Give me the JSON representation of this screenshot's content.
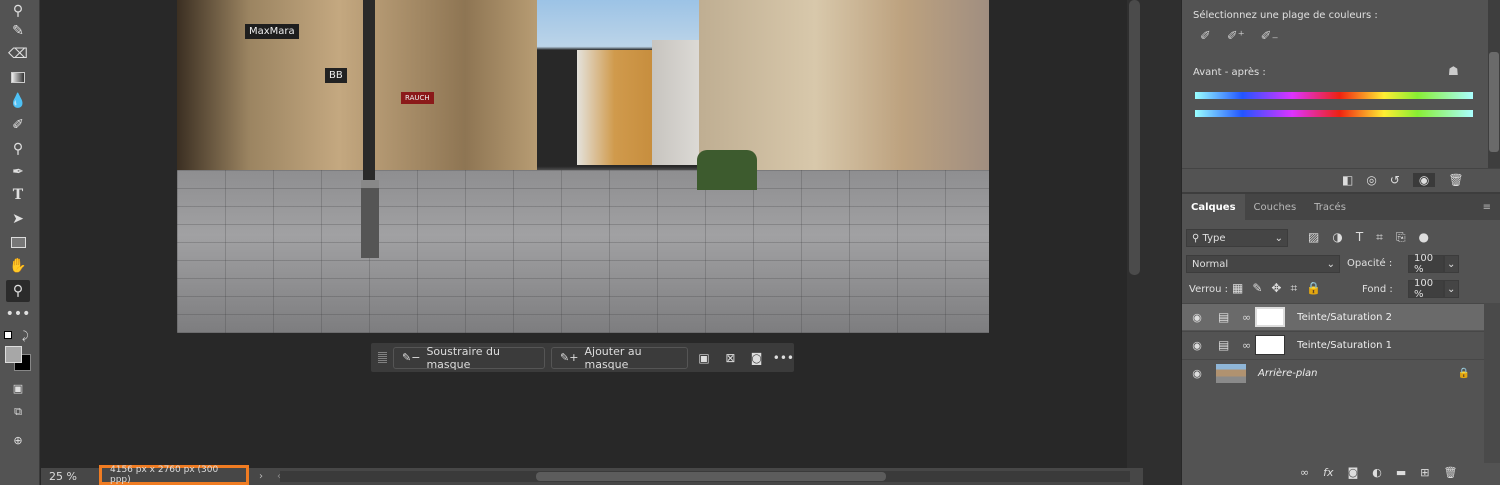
{
  "toolbar": {
    "tools": [
      "stamp-icon",
      "history-brush-icon",
      "eraser-icon",
      "gradient-icon",
      "blur-icon",
      "dodge-icon",
      "sponge-icon",
      "pen-icon",
      "type-icon",
      "path-selection-icon",
      "rectangle-icon",
      "hand-icon",
      "zoom-icon",
      "more-icon"
    ],
    "type_glyph": "T"
  },
  "context_bar": {
    "subtract_label": "Soustraire du masque",
    "add_label": "Ajouter au masque",
    "more": "•••"
  },
  "status": {
    "zoom": "25 %",
    "doc_info": "4156 px x 2760 px (300 ppp)",
    "arrow": "›",
    "left_arrow": "‹"
  },
  "photo": {
    "signs": [
      "MaxMara",
      "BB",
      "RAUCH"
    ]
  },
  "properties": {
    "select_range_label": "Sélectionnez une plage de couleurs :",
    "before_after_label": "Avant - après :"
  },
  "layers_panel": {
    "tabs": [
      "Calques",
      "Couches",
      "Tracés"
    ],
    "filter": "Type",
    "blend_mode": "Normal",
    "opacity_label": "Opacité :",
    "opacity": "100 %",
    "lock_label": "Verrou :",
    "fill_label": "Fond :",
    "fill": "100 %",
    "layers": [
      {
        "name": "Teinte/Saturation 2",
        "selected": true
      },
      {
        "name": "Teinte/Saturation 1",
        "selected": false
      },
      {
        "name": "Arrière-plan",
        "selected": false
      }
    ]
  },
  "colors": {
    "accent_outline": "#f07c22"
  }
}
